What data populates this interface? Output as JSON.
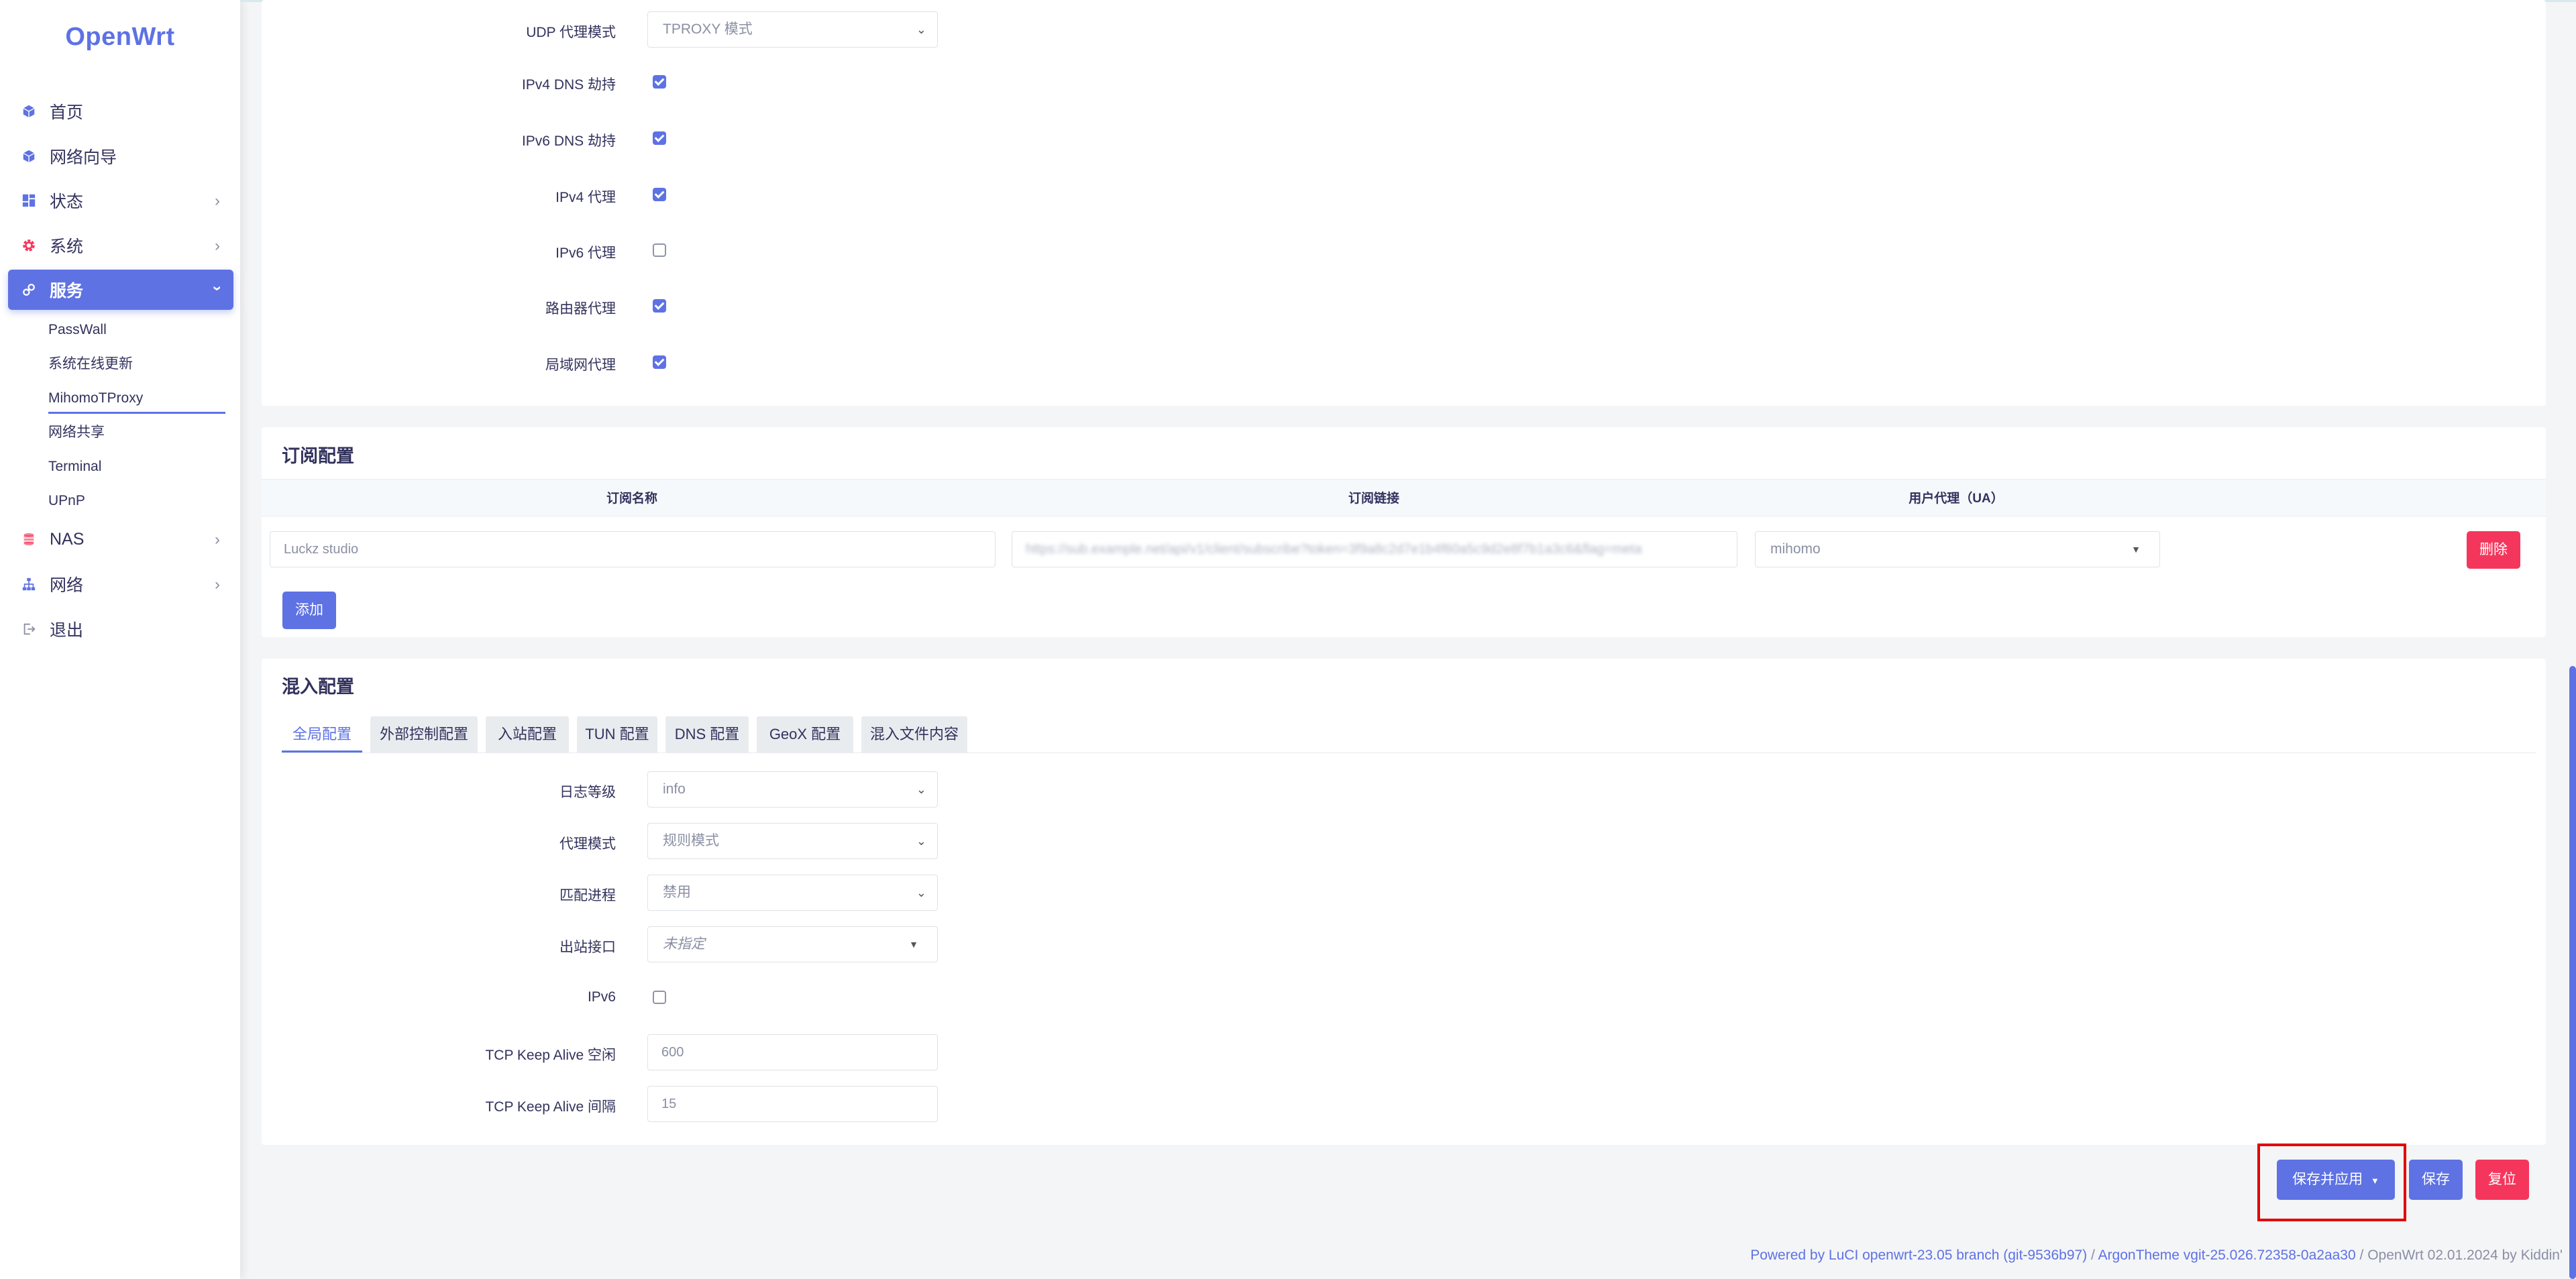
{
  "brand": {
    "logo": "OpenWrt"
  },
  "sidebar": {
    "items": [
      {
        "label": "首页",
        "icon": "cube-icon"
      },
      {
        "label": "网络向导",
        "icon": "cube-icon"
      },
      {
        "label": "状态",
        "icon": "dashboard-icon"
      },
      {
        "label": "系统",
        "icon": "gear-icon"
      },
      {
        "label": "服务",
        "icon": "link-icon"
      },
      {
        "label": "NAS",
        "icon": "database-icon"
      },
      {
        "label": "网络",
        "icon": "sitemap-icon"
      },
      {
        "label": "退出",
        "icon": "logout-icon"
      }
    ],
    "services_submenu": [
      "PassWall",
      "系统在线更新",
      "MihomoTProxy",
      "网络共享",
      "Terminal",
      "UPnP"
    ],
    "active_item": "服务",
    "current_subitem": "MihomoTProxy"
  },
  "proxy": {
    "udp_mode_label": "UDP 代理模式",
    "udp_mode_value": "TPROXY 模式",
    "ipv4_dns_label": "IPv4 DNS 劫持",
    "ipv4_dns_checked": true,
    "ipv6_dns_label": "IPv6 DNS 劫持",
    "ipv6_dns_checked": true,
    "ipv4_proxy_label": "IPv4 代理",
    "ipv4_proxy_checked": true,
    "ipv6_proxy_label": "IPv6 代理",
    "ipv6_proxy_checked": false,
    "router_proxy_label": "路由器代理",
    "router_proxy_checked": true,
    "lan_proxy_label": "局域网代理",
    "lan_proxy_checked": true
  },
  "subscription": {
    "title": "订阅配置",
    "col_name": "订阅名称",
    "col_url": "订阅链接",
    "col_ua": "用户代理（UA）",
    "rows": [
      {
        "name": "Luckz studio",
        "url": "https://sub.example.net/api/v1/client/subscribe?token=3f9a8c2d7e1b4f60a5c9d2e8f7b1a3c6&flag=meta",
        "ua": "mihomo"
      }
    ],
    "delete_label": "删除",
    "add_label": "添加"
  },
  "mixin": {
    "title": "混入配置",
    "tabs": [
      "全局配置",
      "外部控制配置",
      "入站配置",
      "TUN 配置",
      "DNS 配置",
      "GeoX 配置",
      "混入文件内容"
    ],
    "active_tab": "全局配置",
    "log_level_label": "日志等级",
    "log_level_value": "info",
    "proxy_mode_label": "代理模式",
    "proxy_mode_value": "规则模式",
    "match_process_label": "匹配进程",
    "match_process_value": "禁用",
    "outbound_iface_label": "出站接口",
    "outbound_iface_value": "未指定",
    "ipv6_label": "IPv6",
    "ipv6_checked": false,
    "keepalive_idle_label": "TCP Keep Alive 空闲",
    "keepalive_idle_value": "600",
    "keepalive_interval_label": "TCP Keep Alive 间隔",
    "keepalive_interval_value": "15"
  },
  "actions": {
    "save_apply": "保存并应用",
    "save": "保存",
    "reset": "复位"
  },
  "footer": {
    "powered": "Powered by LuCI openwrt-23.05 branch (git-9536b97)",
    "sep1": " / ",
    "theme": "ArgonTheme vgit-25.026.72358-0a2aa30",
    "sep2": " / ",
    "os": "OpenWrt 02.01.2024 by Kiddin'"
  },
  "colors": {
    "accent": "#5e72e4",
    "danger": "#f5365c",
    "highlight_box": "#e30000"
  }
}
